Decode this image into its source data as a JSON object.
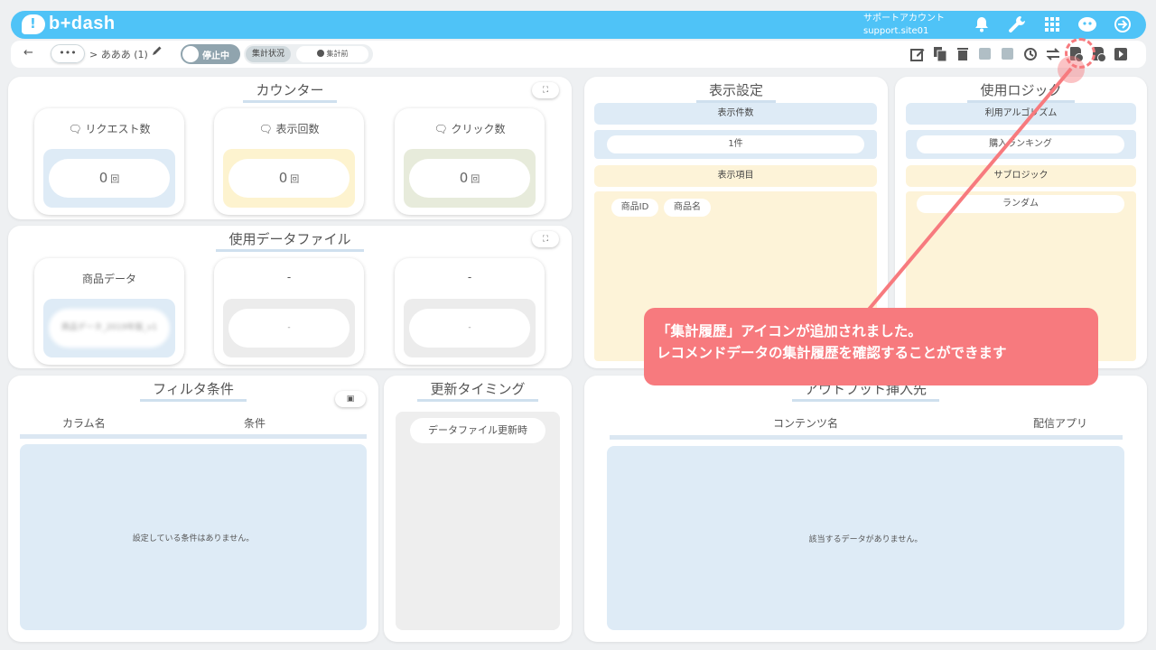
{
  "header": {
    "brand": "b+dash",
    "account_name": "サポートアカウント",
    "account_id": "support.site01",
    "icons": [
      "bell-icon",
      "wrench-icon",
      "grid-icon",
      "chat-robot-icon",
      "logout-icon"
    ]
  },
  "toolbar": {
    "back_glyph": "←",
    "more_label": "•••",
    "breadcrumb": "> あああ (1)",
    "toggle_label": "停止中",
    "status_label": "集計状況",
    "status_value": "集計前",
    "tool_icons": [
      "edit-icon",
      "copy-icon",
      "trash-icon",
      "download-icon",
      "upload-icon",
      "history-icon",
      "swap-icon",
      "aggregation-history-icon",
      "file-settings-icon",
      "play-icon"
    ]
  },
  "counter": {
    "title": "カウンター",
    "cards": [
      {
        "label": "リクエスト数",
        "value": "0",
        "unit": "回"
      },
      {
        "label": "表示回数",
        "value": "0",
        "unit": "回"
      },
      {
        "label": "クリック数",
        "value": "0",
        "unit": "回"
      }
    ]
  },
  "datafile": {
    "title": "使用データファイル",
    "cards": [
      {
        "label": "商品データ",
        "value": "商品データ_2019年版_v1"
      },
      {
        "label": "-",
        "value": "-"
      },
      {
        "label": "-",
        "value": "-"
      }
    ]
  },
  "display": {
    "title": "表示設定",
    "count_head": "表示件数",
    "count_value": "1件",
    "items_head": "表示項目",
    "items": [
      "商品ID",
      "商品名"
    ]
  },
  "logic": {
    "title": "使用ロジック",
    "algo_head": "利用アルゴリズム",
    "algo_value": "購入ランキング",
    "sub_head": "サブロジック",
    "sub_value": "ランダム"
  },
  "filter": {
    "title": "フィルタ条件",
    "col1": "カラム名",
    "col2": "条件",
    "empty": "設定している条件はありません。"
  },
  "timing": {
    "title": "更新タイミング",
    "value": "データファイル更新時"
  },
  "output": {
    "title": "アウトプット挿入先",
    "col1": "コンテンツ名",
    "col2": "配信アプリ",
    "empty": "該当するデータがありません。"
  },
  "callout": {
    "line1": "「集計履歴」アイコンが追加されました。",
    "line2": "レコメンドデータの集計履歴を確認することができます"
  },
  "colors": {
    "header": "#4fc3f7",
    "card_blue": "#deebf6",
    "card_yellow": "#fdf3cf",
    "card_green": "#e7ebdb",
    "card_gray": "#ececec",
    "section_yellow": "#fdf3d8",
    "accent_red": "#f77a7e"
  }
}
